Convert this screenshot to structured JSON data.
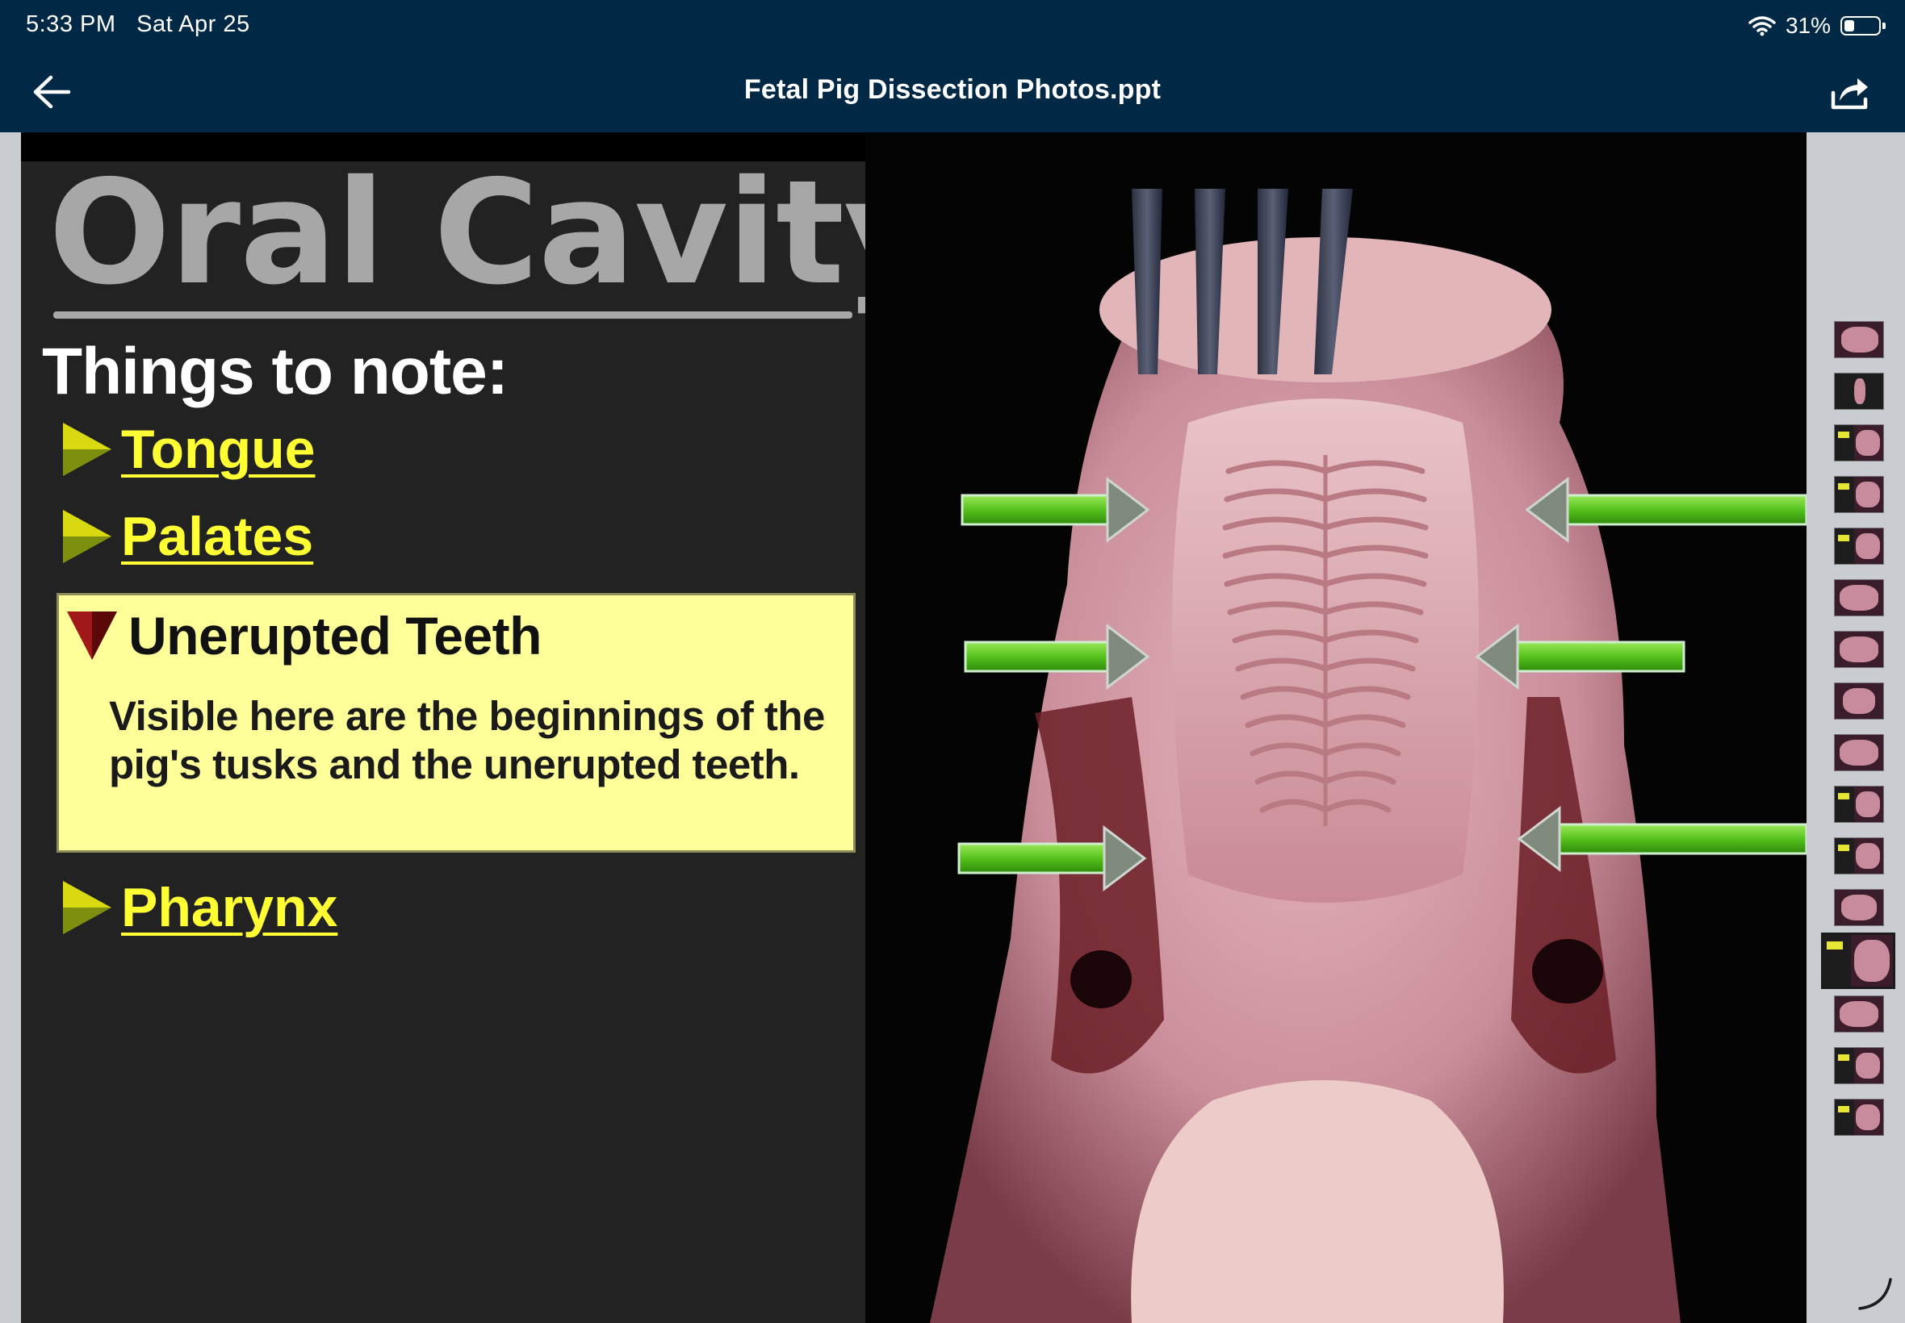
{
  "status_bar": {
    "time": "5:33 PM",
    "date": "Sat Apr 25",
    "battery": "31%",
    "battery_level": 0.31
  },
  "nav_bar": {
    "title": "Fetal Pig Dissection Photos.ppt",
    "back_icon": "arrow-left-icon",
    "share_icon": "share-icon"
  },
  "slide": {
    "heading": "Oral Cavity",
    "subheading": "Things to note:",
    "bullets": [
      {
        "label": "Tongue"
      },
      {
        "label": "Palates"
      },
      {
        "label": "Pharynx"
      }
    ],
    "callout": {
      "title": "Unerupted Teeth",
      "body": "Visible here are the beginnings of the pig's tusks and the unerupted teeth."
    }
  },
  "thumbnails": {
    "count": 16,
    "active_index": 12
  },
  "colors": {
    "nav_bg": "#012945",
    "slide_panel": "#222222",
    "heading_gray": "#a7a7a7",
    "link_yellow": "#ffff33",
    "callout_bg": "#ffff99",
    "arrow_green": "#6fd12e"
  }
}
